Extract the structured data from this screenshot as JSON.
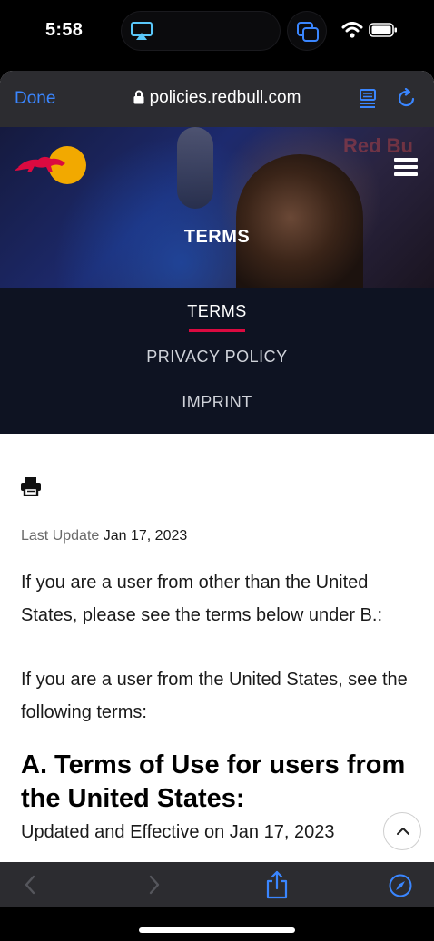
{
  "status_bar": {
    "time": "5:58"
  },
  "browser": {
    "done_label": "Done",
    "url": "policies.redbull.com"
  },
  "hero": {
    "title": "TERMS",
    "background_sign": "Red Bu"
  },
  "tabs": [
    {
      "label": "TERMS",
      "active": true
    },
    {
      "label": "PRIVACY POLICY",
      "active": false
    },
    {
      "label": "IMPRINT",
      "active": false
    }
  ],
  "content": {
    "last_update_label": "Last Update",
    "last_update_value": "Jan 17, 2023",
    "para1": "If you are a user from other than the United States, please see the terms below under B.:",
    "para2": "If you are a user from the United States, see the following terms:",
    "heading": "A. Terms of Use for users from the United States:",
    "effective": "Updated and Effective on Jan 17, 2023"
  },
  "colors": {
    "accent": "#3a86ff",
    "brand_red": "#db0a40",
    "tab_bg": "#0e1322"
  },
  "icons": [
    "airplay-icon",
    "multitasking-icon",
    "wifi-icon",
    "battery-icon",
    "lock-icon",
    "reader-icon",
    "reload-icon",
    "redbull-logo",
    "menu-icon",
    "print-icon",
    "chevron-up-icon",
    "back-icon",
    "forward-icon",
    "share-icon",
    "compass-icon"
  ]
}
